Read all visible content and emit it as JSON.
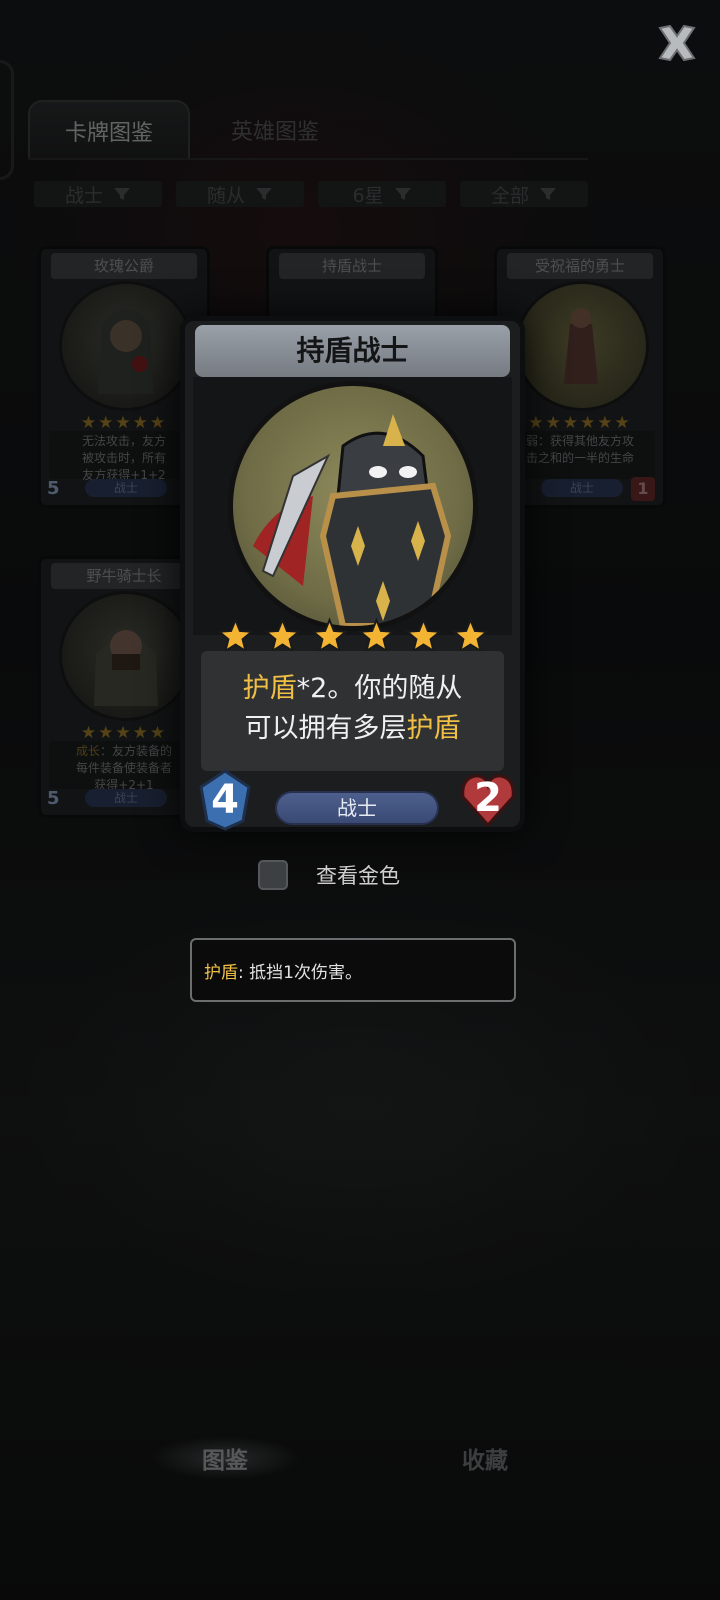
{
  "tabs": [
    {
      "label": "卡牌图鉴"
    },
    {
      "label": "英雄图鉴"
    }
  ],
  "filters": [
    {
      "label": "战士"
    },
    {
      "label": "随从"
    },
    {
      "label": "6星"
    },
    {
      "label": "全部"
    }
  ],
  "grid_cards": [
    {
      "name": "玫瑰公爵",
      "stars": "★★★★★",
      "desc_lines": [
        "无法攻击，友方",
        "被攻击时，所有",
        "友方获得+1+2"
      ],
      "cost": "5",
      "class": "战士",
      "hp": ""
    },
    {
      "name": "持盾战士"
    },
    {
      "name": "受祝福的勇士",
      "stars": "★★★★★★",
      "desc_lines": [
        "弱：获得其他友方攻",
        "击之和的一半的生命"
      ],
      "cost": "",
      "class": "战士",
      "hp": "1"
    },
    {
      "name": "野牛骑士长",
      "stars": "★★★★★",
      "desc_keyword": "成长",
      "desc_rest": "：友方装备的",
      "desc_lines": [
        "每件装备使装备者",
        "获得+2+1"
      ],
      "cost": "5",
      "class": "战士",
      "hp": ""
    }
  ],
  "selected_card": {
    "name": "持盾战士",
    "star_count": 6,
    "desc_kw1": "护盾",
    "desc_mid": "*2。你的随从",
    "desc_line2": "可以拥有多层",
    "desc_kw2": "护盾",
    "cost": "4",
    "class": "战士",
    "hp": "2"
  },
  "gold_toggle": {
    "label": "查看金色",
    "checked": false
  },
  "tooltip": {
    "keyword": "护盾",
    "text": ": 抵挡1次伤害。"
  },
  "bottom_nav": [
    {
      "label": "图鉴"
    },
    {
      "label": "收藏"
    }
  ],
  "colors": {
    "gold": "#f0c046",
    "class_badge": "#4d5f8c",
    "cost_gem": "#3b6fb0",
    "hp_heart": "#b0393b"
  }
}
